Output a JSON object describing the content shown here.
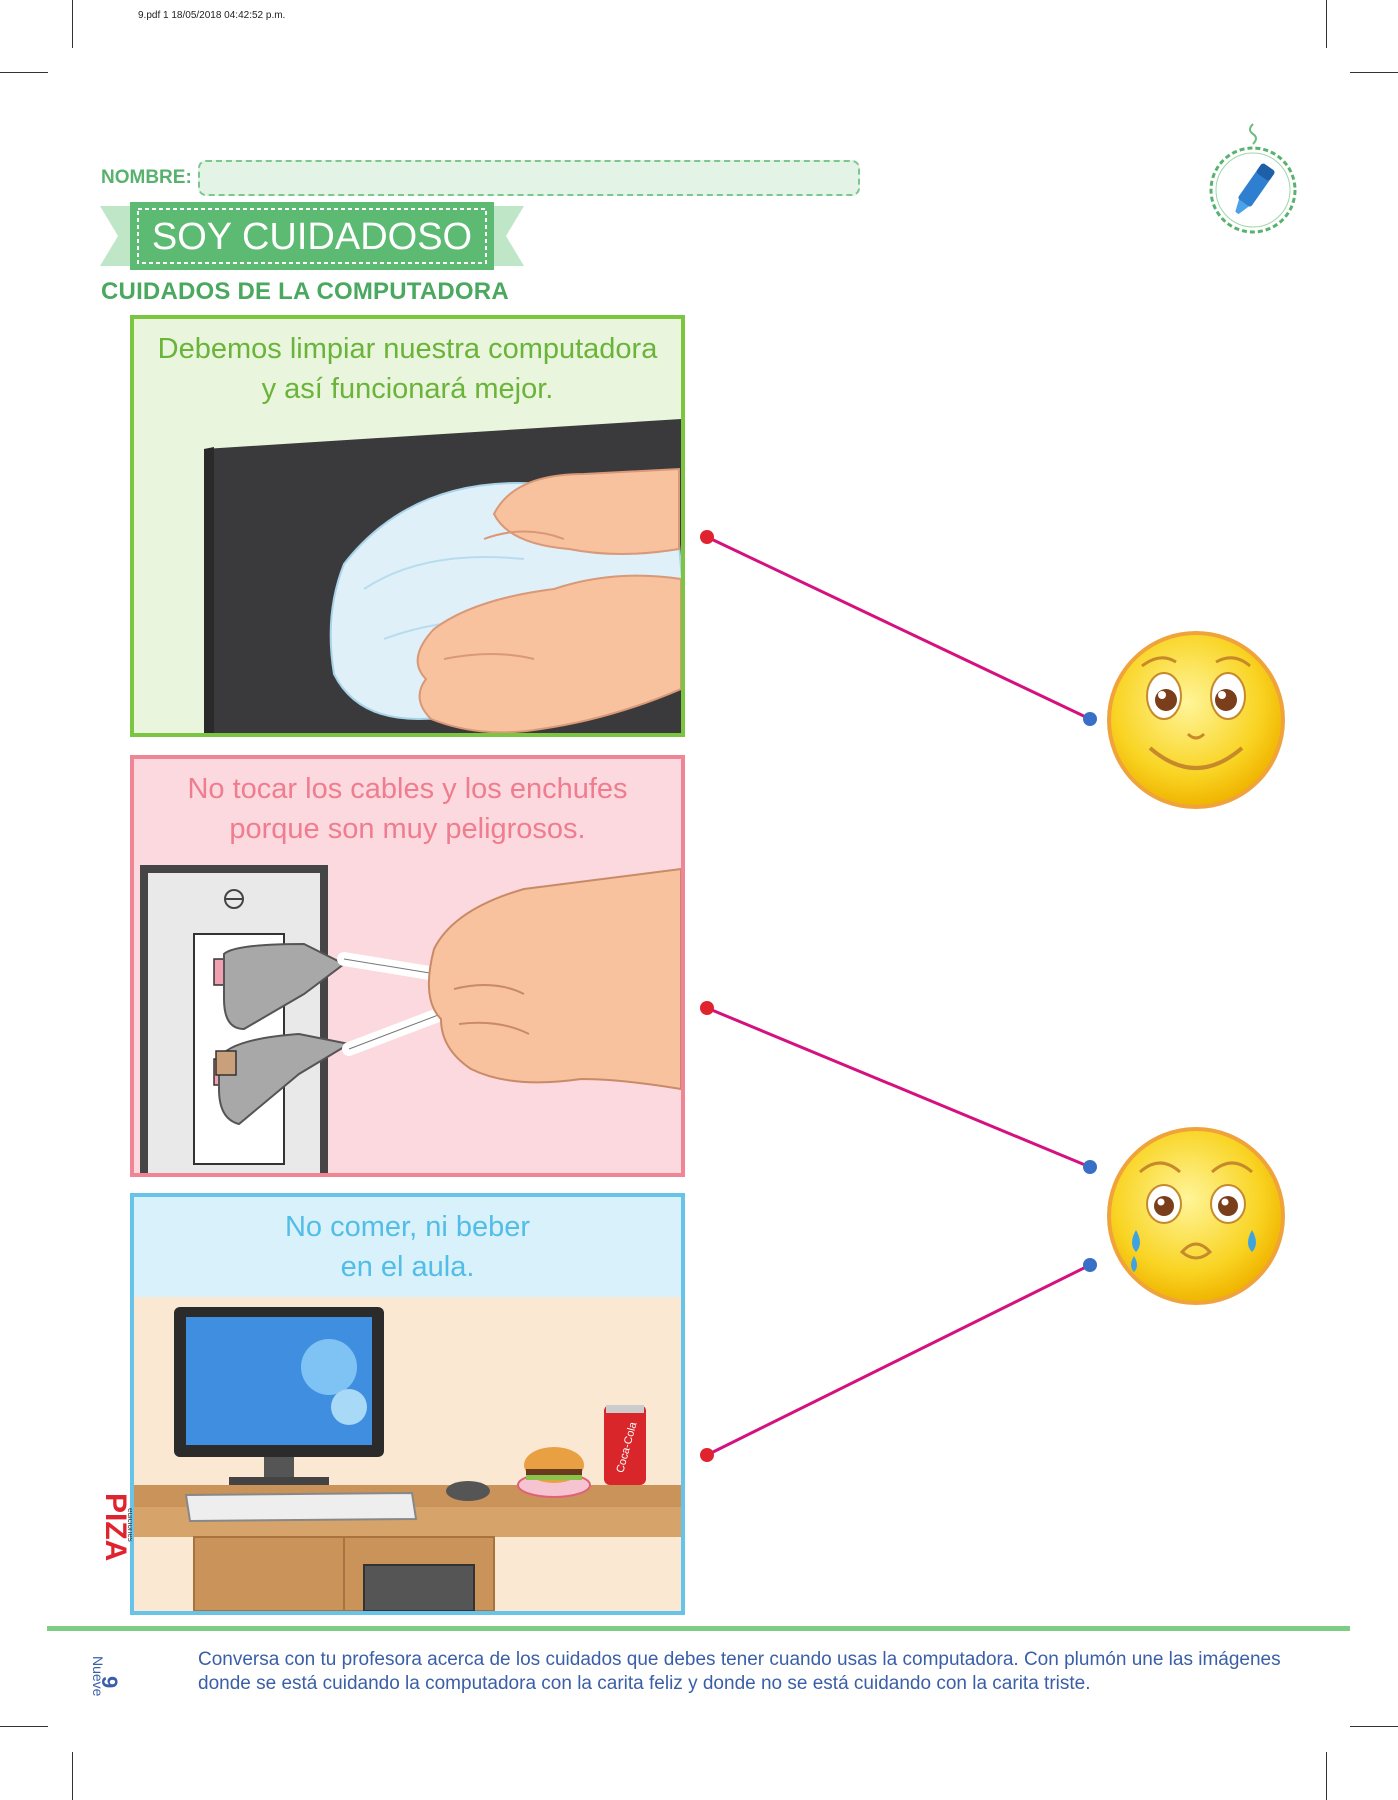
{
  "header": {
    "meta": "9.pdf   1   18/05/2018   04:42:52 p.m."
  },
  "name": {
    "label": "NOMBRE:"
  },
  "title": "SOY CUIDADOSO",
  "subtitle": "CUIDADOS DE LA COMPUTADORA",
  "panels": [
    {
      "line1": "Debemos limpiar nuestra computadora",
      "line2": "y así funcionará mejor.",
      "color": "#7cc540",
      "bg": "#eaf5dd",
      "text_color": "#6ab43a"
    },
    {
      "line1": "No tocar los cables y los enchufes",
      "line2": "porque son muy peligrosos.",
      "color": "#f08596",
      "bg": "#fbd9de",
      "text_color": "#ef7d8f"
    },
    {
      "line1": "No comer, ni beber",
      "line2": "en el aula.",
      "color": "#67c4e8",
      "bg": "#d8f1fb",
      "text_color": "#52bde6"
    }
  ],
  "can_label": "Coca-Cola",
  "brand": {
    "name": "PIZA",
    "sub": "ediciones"
  },
  "footer": {
    "instruction": "Conversa con tu profesora acerca de los cuidados que debes tener cuando usas la computadora. Con plumón une las imágenes donde se está cuidando la computadora con la carita feliz y donde no se está cuidando con la carita triste.",
    "page_number": "9",
    "page_word": "Nueve"
  },
  "colors": {
    "green": "#58b26d",
    "line": "#d4117f",
    "dot_left": "#e0242f",
    "dot_right": "#3a6fc8",
    "face": "#f9d423"
  }
}
